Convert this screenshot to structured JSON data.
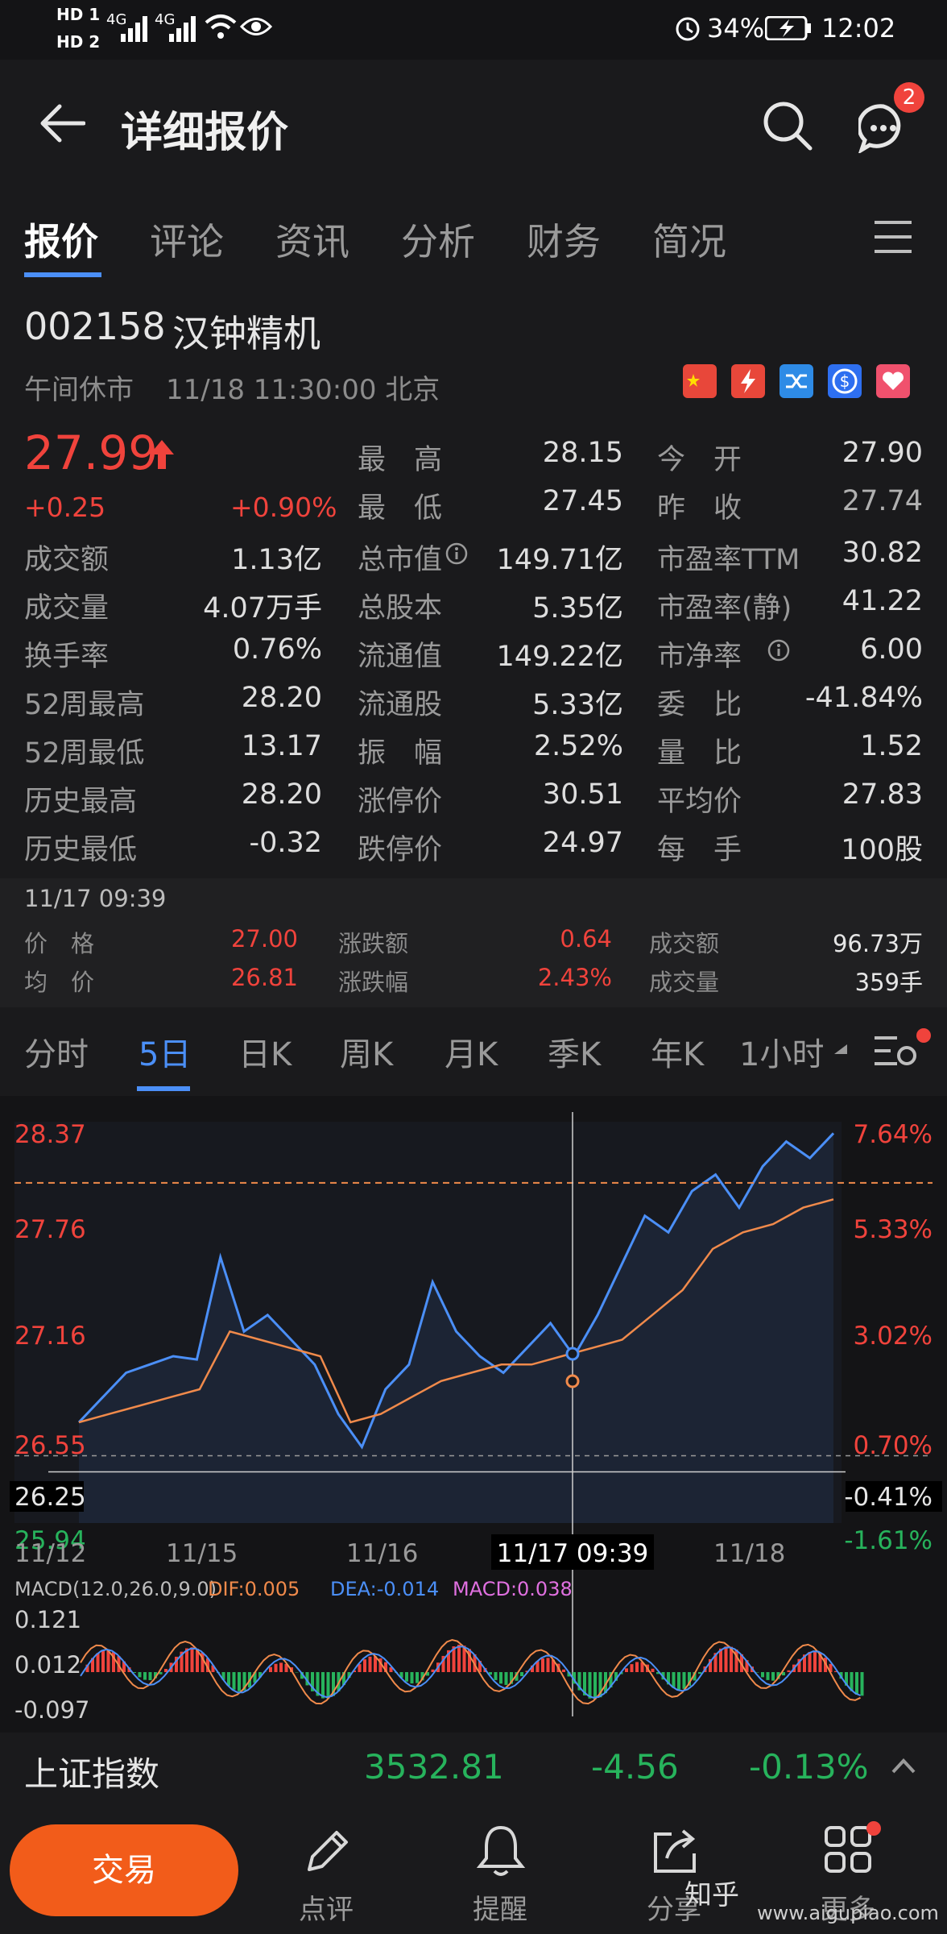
{
  "status_bar": {
    "sim1": "HD 1",
    "sim2": "HD 2",
    "net1": "4G",
    "net2": "4G",
    "battery": "34%",
    "time": "12:02"
  },
  "header": {
    "title": "详细报价",
    "message_badge": "2"
  },
  "tabs": [
    "报价",
    "评论",
    "资讯",
    "分析",
    "财务",
    "简况"
  ],
  "stock": {
    "code": "002158",
    "name": "汉钟精机",
    "status": "午间休市",
    "datetime": "11/18 11:30:00 北京",
    "price": "27.99",
    "change": "+0.25",
    "change_pct": "+0.90%"
  },
  "quote_rows": [
    [
      "最　高",
      "28.15",
      "今　开",
      "27.90"
    ],
    [
      "最　低",
      "27.45",
      "昨　收",
      "27.74"
    ]
  ],
  "quote_grid": [
    [
      "成交额",
      "1.13亿",
      "总市值",
      "149.71亿",
      "市盈率TTM",
      "30.82"
    ],
    [
      "成交量",
      "4.07万手",
      "总股本",
      "5.35亿",
      "市盈率(静)",
      "41.22"
    ],
    [
      "换手率",
      "0.76%",
      "流通值",
      "149.22亿",
      "市净率",
      "6.00"
    ],
    [
      "52周最高",
      "28.20",
      "流通股",
      "5.33亿",
      "委　比",
      "-41.84%"
    ],
    [
      "52周最低",
      "13.17",
      "振　幅",
      "2.52%",
      "量　比",
      "1.52"
    ],
    [
      "历史最高",
      "28.20",
      "涨停价",
      "30.51",
      "平均价",
      "27.83"
    ],
    [
      "历史最低",
      "-0.32",
      "跌停价",
      "24.97",
      "每　手",
      "100股"
    ]
  ],
  "tooltip": {
    "time": "11/17 09:39",
    "price_label": "价　格",
    "price": "27.00",
    "avg_label": "均　价",
    "avg": "26.81",
    "chg_label": "涨跌额",
    "chg": "0.64",
    "chgpct_label": "涨跌幅",
    "chgpct": "2.43%",
    "amount_label": "成交额",
    "amount": "96.73万",
    "volume_label": "成交量",
    "volume": "359手"
  },
  "kline_tabs": [
    "分时",
    "5日",
    "日K",
    "周K",
    "月K",
    "季K",
    "年K",
    "1小时"
  ],
  "chart": {
    "y_left": [
      "28.37",
      "27.76",
      "27.16",
      "26.55",
      "26.25",
      "25.94"
    ],
    "y_right": [
      "7.64%",
      "5.33%",
      "3.02%",
      "0.70%",
      "-0.41%",
      "-1.61%"
    ],
    "x_labels": [
      "11/12",
      "11/15",
      "11/16",
      "11/18"
    ],
    "crosshair_label": "11/17 09:39",
    "macd_title": "MACD(12.0,26.0,9.0)",
    "dif": "DIF:0.005",
    "dea": "DEA:-0.014",
    "macd": "MACD:0.038",
    "macd_y": [
      "0.121",
      "0.012",
      "-0.097"
    ]
  },
  "chart_data": {
    "type": "line",
    "x_days": [
      "11/12",
      "11/15",
      "11/16",
      "11/17",
      "11/18"
    ],
    "series": [
      {
        "values": [
          26.55,
          26.7,
          26.85,
          26.9,
          26.95,
          26.93,
          27.55,
          27.1,
          27.2,
          27.05,
          26.9,
          26.6,
          26.4,
          26.75,
          26.9,
          27.4,
          27.1,
          26.95,
          26.85,
          27.0,
          27.15,
          26.95,
          27.2,
          27.5,
          27.8,
          27.7,
          27.95,
          28.05,
          27.85,
          28.1,
          28.25,
          28.15,
          28.3
        ]
      },
      {
        "values": [
          26.55,
          26.6,
          26.65,
          26.7,
          26.75,
          27.1,
          27.05,
          27.0,
          26.95,
          26.55,
          26.6,
          26.7,
          26.8,
          26.85,
          26.9,
          26.9,
          26.95,
          27.0,
          27.05,
          27.2,
          27.35,
          27.6,
          27.7,
          27.75,
          27.85,
          27.9
        ]
      }
    ],
    "ylim": [
      25.94,
      28.37
    ],
    "reference_price": 26.25
  },
  "index_bar": {
    "name": "上证指数",
    "value": "3532.81",
    "change": "-4.56",
    "change_pct": "-0.13%"
  },
  "bottom_nav": {
    "trade": "交易",
    "comment": "点评",
    "remind": "提醒",
    "share": "分享",
    "more": "更多"
  },
  "watermark": {
    "site": "www.aigupiao.com",
    "zhihu": "知乎"
  },
  "colors": {
    "up": "#f0433c",
    "down": "#27b35c",
    "accent": "#4b8ff7",
    "avg": "#f08a4b",
    "trade": "#f25c1a"
  }
}
